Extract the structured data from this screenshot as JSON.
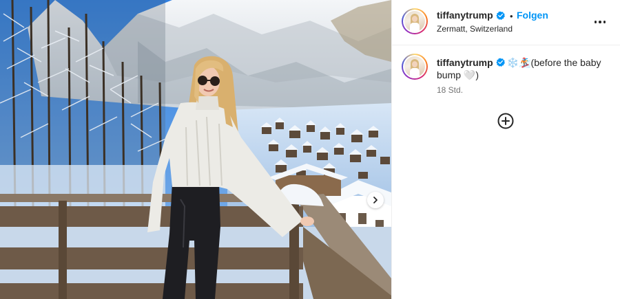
{
  "post": {
    "username": "tiffanytrump",
    "separator": "•",
    "follow_label": "Folgen",
    "location": "Zermatt, Switzerland",
    "more_icon": "more-horizontal-icon"
  },
  "caption": {
    "username": "tiffanytrump",
    "emojis": "❄️🏂",
    "text": "(before the baby bump 🤍)",
    "time": "18 Std."
  },
  "icons": {
    "verified": "verified-badge-icon",
    "next": "chevron-right-icon",
    "add": "add-comment-icon"
  },
  "colors": {
    "link_blue": "#0095f6",
    "verified_blue": "#0095f6",
    "text": "#262626",
    "secondary_text": "#737373"
  }
}
